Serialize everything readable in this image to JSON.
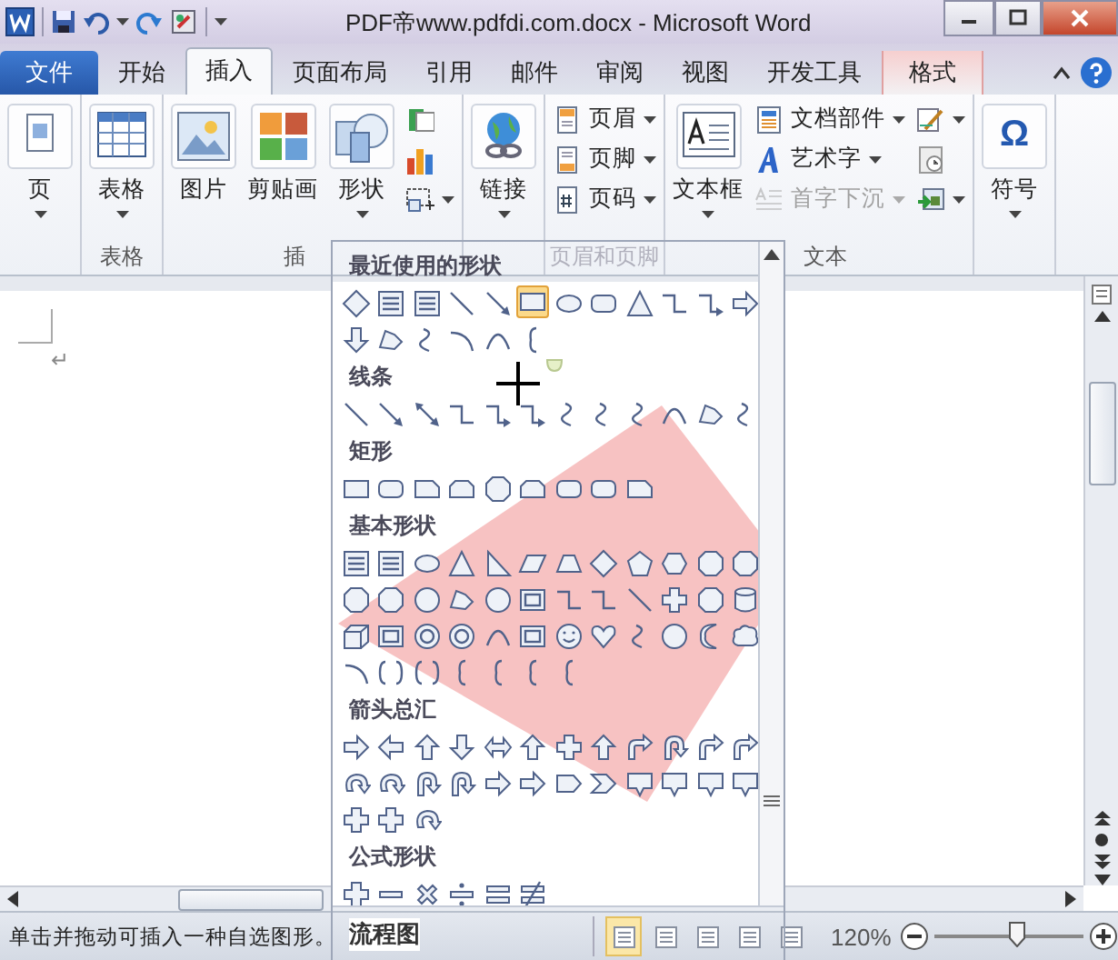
{
  "title_bar": {
    "title": "PDF帝www.pdfdi.com.docx  -  Microsoft Word"
  },
  "tabs": [
    {
      "label": "文件",
      "kind": "file",
      "selected": false
    },
    {
      "label": "开始",
      "kind": "normal",
      "selected": false
    },
    {
      "label": "插入",
      "kind": "normal",
      "selected": true
    },
    {
      "label": "页面布局",
      "kind": "normal",
      "selected": false
    },
    {
      "label": "引用",
      "kind": "normal",
      "selected": false
    },
    {
      "label": "邮件",
      "kind": "normal",
      "selected": false
    },
    {
      "label": "审阅",
      "kind": "normal",
      "selected": false
    },
    {
      "label": "视图",
      "kind": "normal",
      "selected": false
    },
    {
      "label": "开发工具",
      "kind": "normal",
      "selected": false
    },
    {
      "label": "格式",
      "kind": "contextual",
      "selected": false
    }
  ],
  "ribbon": {
    "groups": [
      {
        "items": [
          {
            "kind": "large",
            "label": "页",
            "dropdown": true,
            "disabled": false
          }
        ]
      },
      {
        "label": "表格",
        "items": [
          {
            "kind": "large",
            "label": "表格",
            "dropdown": true,
            "disabled": false
          }
        ]
      },
      {
        "label": "插",
        "items": [
          {
            "kind": "large",
            "label": "图片",
            "dropdown": false,
            "disabled": false
          },
          {
            "kind": "large",
            "label": "剪贴画",
            "dropdown": false,
            "disabled": false
          },
          {
            "kind": "large",
            "label": "形状",
            "dropdown": true,
            "disabled": false
          },
          {
            "kind": "stack",
            "buttons": [
              {
                "dropdown": false,
                "disabled": false
              },
              {
                "dropdown": false,
                "disabled": false
              },
              {
                "dropdown": true,
                "disabled": false
              }
            ]
          }
        ]
      },
      {
        "items": [
          {
            "kind": "large",
            "label": "链接",
            "dropdown": true,
            "disabled": false
          }
        ]
      },
      {
        "label": "页眉和页脚",
        "items": [
          {
            "kind": "stack",
            "buttons": [
              {
                "label": "页眉",
                "dropdown": true,
                "disabled": false
              },
              {
                "label": "页脚",
                "dropdown": true,
                "disabled": false
              },
              {
                "label": "页码",
                "dropdown": true,
                "disabled": false
              }
            ]
          }
        ]
      },
      {
        "label": "文本",
        "items": [
          {
            "kind": "large",
            "label": "文本框",
            "dropdown": true,
            "disabled": false
          },
          {
            "kind": "stack",
            "buttons": [
              {
                "label": "文档部件",
                "dropdown": true,
                "disabled": false
              },
              {
                "label": "艺术字",
                "dropdown": true,
                "disabled": false
              },
              {
                "label": "首字下沉",
                "dropdown": true,
                "disabled": true
              }
            ]
          },
          {
            "kind": "stack",
            "buttons": [
              {
                "dropdown": true,
                "disabled": false
              },
              {
                "dropdown": false,
                "disabled": false
              },
              {
                "dropdown": true,
                "disabled": false
              }
            ]
          }
        ]
      },
      {
        "items": [
          {
            "kind": "large",
            "label": "符号",
            "glyph": "Ω",
            "dropdown": true,
            "disabled": false
          }
        ]
      }
    ]
  },
  "document": {
    "paragraph_mark": "↵"
  },
  "shape_gallery": {
    "sections": [
      {
        "title": "最近使用的形状",
        "shapes": [
          {
            "selected": false
          },
          {
            "selected": false
          },
          {
            "selected": false
          },
          {
            "selected": false
          },
          {
            "selected": false
          },
          {
            "selected": true
          },
          {
            "selected": false
          },
          {
            "selected": false
          },
          {
            "selected": false
          },
          {
            "selected": false
          },
          {
            "selected": false
          },
          {
            "selected": false
          },
          {
            "selected": false
          },
          {
            "selected": false
          },
          {
            "selected": false
          },
          {
            "selected": false
          },
          {
            "selected": false
          },
          {
            "selected": false
          }
        ]
      },
      {
        "title": "线条",
        "shapes": [
          {
            "selected": false
          },
          {
            "selected": false
          },
          {
            "selected": false
          },
          {
            "selected": false
          },
          {
            "selected": false
          },
          {
            "selected": false
          },
          {
            "selected": false
          },
          {
            "selected": false
          },
          {
            "selected": false
          },
          {
            "selected": false
          },
          {
            "selected": false
          },
          {
            "selected": false
          }
        ]
      },
      {
        "title": "矩形",
        "shapes": [
          {
            "selected": false
          },
          {
            "selected": false
          },
          {
            "selected": false
          },
          {
            "selected": false
          },
          {
            "selected": false
          },
          {
            "selected": false
          },
          {
            "selected": false
          },
          {
            "selected": false
          },
          {
            "selected": false
          }
        ]
      },
      {
        "title": "基本形状",
        "shapes": [
          {
            "selected": false
          },
          {
            "selected": false
          },
          {
            "selected": false
          },
          {
            "selected": false
          },
          {
            "selected": false
          },
          {
            "selected": false
          },
          {
            "selected": false
          },
          {
            "selected": false
          },
          {
            "selected": false
          },
          {
            "selected": false
          },
          {
            "selected": false
          },
          {
            "selected": false
          },
          {
            "selected": false
          },
          {
            "selected": false
          },
          {
            "selected": false
          },
          {
            "selected": false
          },
          {
            "selected": false
          },
          {
            "selected": false
          },
          {
            "selected": false
          },
          {
            "selected": false
          },
          {
            "selected": false
          },
          {
            "selected": false
          },
          {
            "selected": false
          },
          {
            "selected": false
          },
          {
            "selected": false
          },
          {
            "selected": false
          },
          {
            "selected": false
          },
          {
            "selected": false
          },
          {
            "selected": false
          },
          {
            "selected": false
          },
          {
            "selected": false
          },
          {
            "selected": false
          },
          {
            "selected": false
          },
          {
            "selected": false
          },
          {
            "selected": false
          },
          {
            "selected": false
          },
          {
            "selected": false
          },
          {
            "selected": false
          },
          {
            "selected": false
          },
          {
            "selected": false
          },
          {
            "selected": false
          },
          {
            "selected": false
          },
          {
            "selected": false
          }
        ]
      },
      {
        "title": "箭头总汇",
        "shapes": [
          {
            "selected": false
          },
          {
            "selected": false
          },
          {
            "selected": false
          },
          {
            "selected": false
          },
          {
            "selected": false
          },
          {
            "selected": false
          },
          {
            "selected": false
          },
          {
            "selected": false
          },
          {
            "selected": false
          },
          {
            "selected": false
          },
          {
            "selected": false
          },
          {
            "selected": false
          },
          {
            "selected": false
          },
          {
            "selected": false
          },
          {
            "selected": false
          },
          {
            "selected": false
          },
          {
            "selected": false
          },
          {
            "selected": false
          },
          {
            "selected": false
          },
          {
            "selected": false
          },
          {
            "selected": false
          },
          {
            "selected": false
          },
          {
            "selected": false
          },
          {
            "selected": false
          },
          {
            "selected": false
          },
          {
            "selected": false
          },
          {
            "selected": false
          }
        ]
      },
      {
        "title": "公式形状",
        "shapes": [
          {
            "selected": false
          },
          {
            "selected": false
          },
          {
            "selected": false
          },
          {
            "selected": false
          },
          {
            "selected": false
          },
          {
            "selected": false
          }
        ]
      }
    ],
    "footer_title": "流程图"
  },
  "status_bar": {
    "message": "单击并拖动可插入一种自选图形。",
    "views": [
      {
        "selected": true
      },
      {
        "selected": false
      },
      {
        "selected": false
      },
      {
        "selected": false
      },
      {
        "selected": false
      }
    ],
    "zoom": {
      "reading": "120%",
      "level": 0.55
    }
  }
}
